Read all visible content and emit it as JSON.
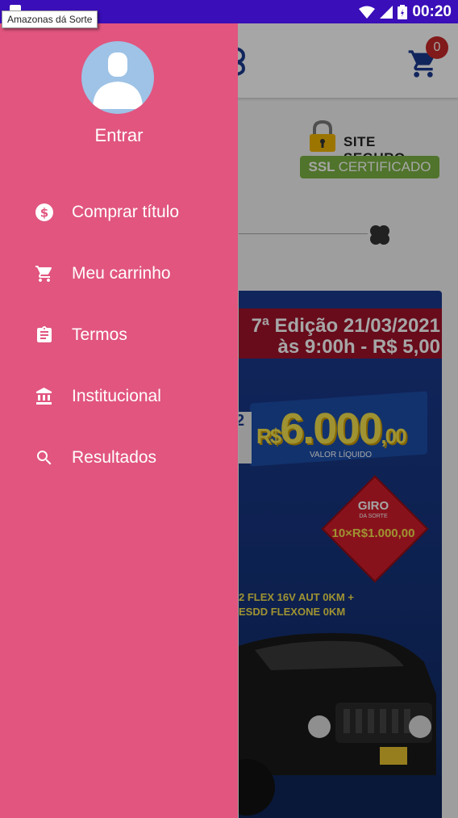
{
  "status_bar": {
    "time": "00:20",
    "tooltip": "Amazonas dá Sorte"
  },
  "header": {
    "cart_count": "0"
  },
  "security_badge": {
    "site_seguro": "SITE SEGURO",
    "ssl_bold": "SSL",
    "ssl_rest": "CERTIFICADO"
  },
  "banner": {
    "edition_line1": "7ª Edição 21/03/2021",
    "edition_line2": "às 9:00h - R$ 5,00",
    "prize_left": "2",
    "prize_currency": "R$",
    "prize_main": "6.000",
    "prize_cents": ",00",
    "prize_label": "VALOR LÍQUIDO",
    "giro_title": "GIRO",
    "giro_subtitle": "DA SORTE",
    "giro_prize": "10×R$1.000,00",
    "car_line1": "2 FLEX 16V AUT 0KM +",
    "car_line2": "ESDD FLEXONE 0KM"
  },
  "drawer": {
    "login_label": "Entrar",
    "menu": [
      {
        "label": "Comprar título",
        "icon": "dollar-circle-icon"
      },
      {
        "label": "Meu carrinho",
        "icon": "cart-icon"
      },
      {
        "label": "Termos",
        "icon": "clipboard-icon"
      },
      {
        "label": "Institucional",
        "icon": "bank-icon"
      },
      {
        "label": "Resultados",
        "icon": "search-icon"
      }
    ]
  },
  "colors": {
    "status_bar": "#3a0eb8",
    "drawer": "#e1557f",
    "ssl_green": "#7cb342",
    "badge_red": "#c62828"
  }
}
